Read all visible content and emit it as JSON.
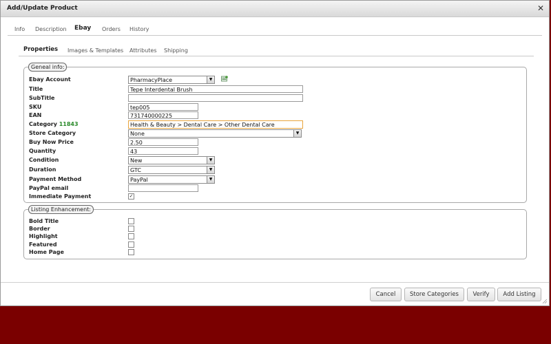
{
  "dialog": {
    "title": "Add/Update Product",
    "close_icon": "close-icon"
  },
  "main_tabs": [
    "Info",
    "Description",
    "Ebay",
    "Orders",
    "History"
  ],
  "sub_tabs": [
    "Properties",
    "Images & Templates",
    "Attributes",
    "Shipping"
  ],
  "general": {
    "legend": "Geneal info:",
    "labels": {
      "ebay_account": "Ebay Account",
      "title": "Title",
      "subtitle": "SubTitle",
      "sku": "SKU",
      "ean": "EAN",
      "category": "Category",
      "category_number": "11843",
      "store_category": "Store Category",
      "buy_now_price": "Buy Now Price",
      "quantity": "Quantity",
      "condition": "Condition",
      "duration": "Duration",
      "payment_method": "Payment Method",
      "paypal_email": "PayPal email",
      "immediate_payment": "Immediate Payment"
    },
    "values": {
      "ebay_account": "PharmacyPlace",
      "title": "Tepe Interdental Brush",
      "subtitle": "",
      "sku": "tep005",
      "ean": "731740000225",
      "category": "Health & Beauty > Dental Care > Other Dental Care",
      "store_category": "None",
      "buy_now_price": "2.50",
      "quantity": "43",
      "condition": "New",
      "duration": "GTC",
      "payment_method": "PayPal",
      "paypal_email": "",
      "immediate_payment": true
    }
  },
  "enhancement": {
    "legend": "Listing Enhancement:",
    "labels": {
      "bold_title": "Bold Title",
      "border": "Border",
      "highlight": "Highlight",
      "featured": "Featured",
      "home_page": "Home Page"
    }
  },
  "buttons": {
    "cancel": "Cancel",
    "store_categories": "Store Categories",
    "verify": "Verify",
    "add_listing": "Add Listing"
  },
  "colors": {
    "background": "#7a0000",
    "category_number": "#2a8a2a",
    "focus_border": "#e8a43b"
  }
}
